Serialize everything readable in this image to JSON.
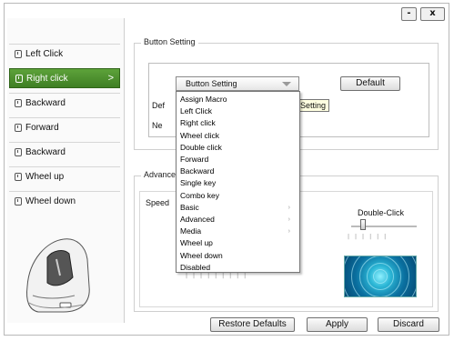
{
  "window": {
    "minimize_label": "-",
    "close_label": "x"
  },
  "sidebar": {
    "items": [
      {
        "label": "Left Click"
      },
      {
        "label": "Right click",
        "active": true
      },
      {
        "label": "Backward"
      },
      {
        "label": "Forward"
      },
      {
        "label": "Backward"
      },
      {
        "label": "Wheel up"
      },
      {
        "label": "Wheel down"
      }
    ],
    "active_chevron": ">"
  },
  "button_setting": {
    "group_title": "Button Setting",
    "combo_value": "Button Setting",
    "default_button": "Default",
    "row1_label_partial": "Def",
    "row2_label_partial": "Ne",
    "tooltip_text": "Setting"
  },
  "dropdown": {
    "items": [
      {
        "label": "Assign Macro"
      },
      {
        "label": "Left Click"
      },
      {
        "label": "Right click"
      },
      {
        "label": "Wheel click"
      },
      {
        "label": "Double click"
      },
      {
        "label": "Forward"
      },
      {
        "label": "Backward"
      },
      {
        "label": "Single key"
      },
      {
        "label": "Combo key"
      },
      {
        "label": "Basic",
        "submenu": true
      },
      {
        "label": "Advanced",
        "submenu": true
      },
      {
        "label": "Media",
        "submenu": true
      },
      {
        "label": "Wheel up"
      },
      {
        "label": "Wheel down"
      },
      {
        "label": "Disabled"
      }
    ],
    "submenu_marker": "›"
  },
  "advanced": {
    "group_title_partial": "Advance",
    "speed_label_partial": "Speed",
    "double_click_label": "Double-Click",
    "double_click_level": 0.15
  },
  "footer": {
    "restore_defaults": "Restore Defaults",
    "apply": "Apply",
    "discard": "Discard"
  }
}
